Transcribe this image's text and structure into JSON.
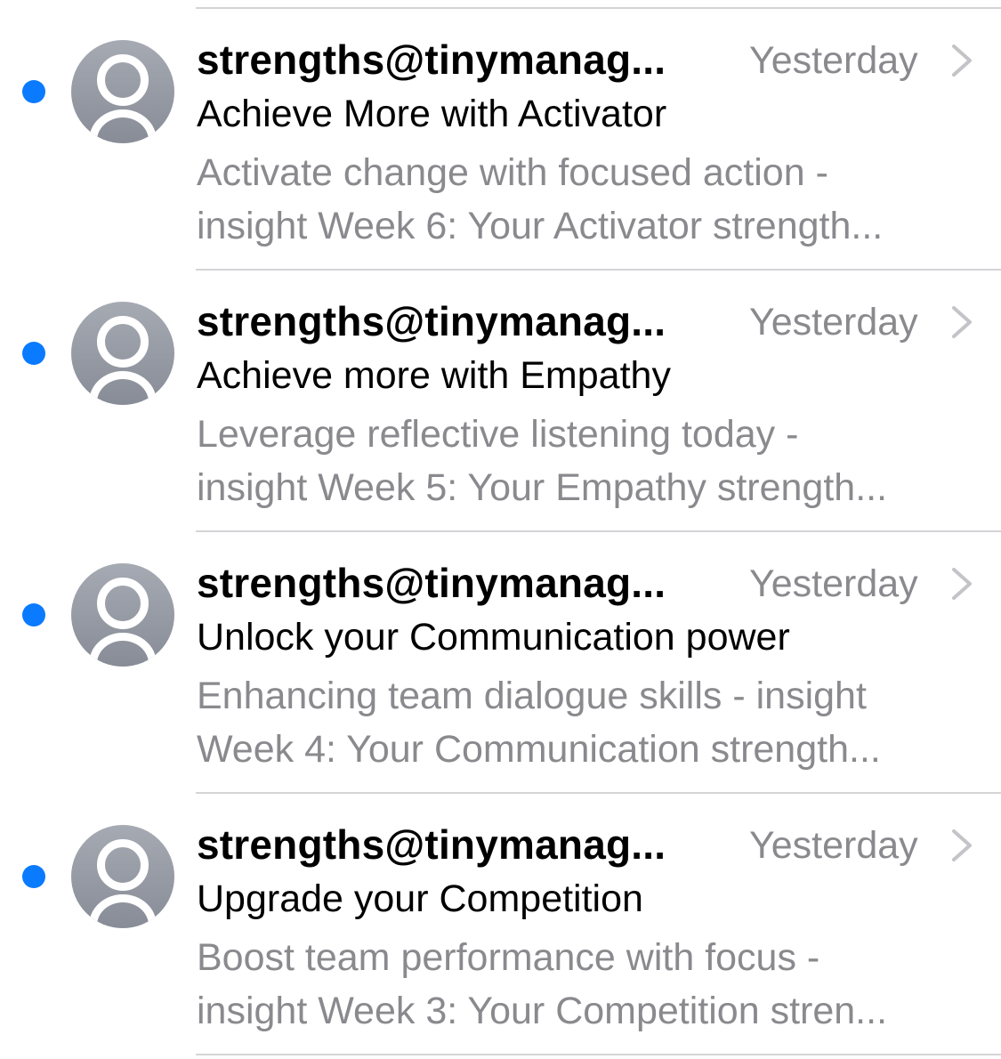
{
  "colors": {
    "unread_dot": "#0a7aff",
    "secondary_text": "#8a8a8e",
    "divider": "#d4d4d8"
  },
  "icons": {
    "avatar": "person-placeholder-icon",
    "chevron": "chevron-right-icon",
    "unread": "unread-dot-icon"
  },
  "messages": [
    {
      "sender": "strengths@tinymanag...",
      "date": "Yesterday",
      "subject": "Achieve More with Activator",
      "preview_line1": "Activate change with focused action -",
      "preview_line2": "insight Week 6: Your Activator strength...",
      "unread": true
    },
    {
      "sender": "strengths@tinymanag...",
      "date": "Yesterday",
      "subject": "Achieve more with Empathy",
      "preview_line1": "Leverage reflective listening today -",
      "preview_line2": "insight Week 5: Your Empathy strength...",
      "unread": true
    },
    {
      "sender": "strengths@tinymanag...",
      "date": "Yesterday",
      "subject": "Unlock your Communication power",
      "preview_line1": "Enhancing team dialogue skills - insight",
      "preview_line2": "Week 4: Your Communication strength...",
      "unread": true
    },
    {
      "sender": "strengths@tinymanag...",
      "date": "Yesterday",
      "subject": "Upgrade your Competition",
      "preview_line1": "Boost team performance with focus -",
      "preview_line2": "insight Week 3: Your Competition stren...",
      "unread": true
    }
  ]
}
